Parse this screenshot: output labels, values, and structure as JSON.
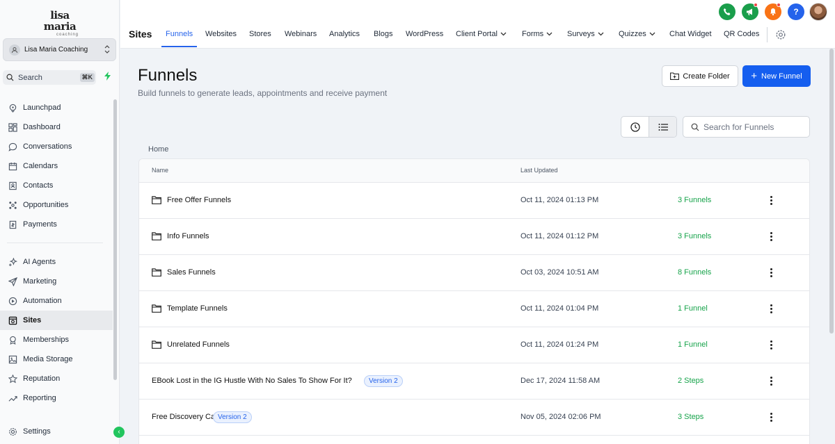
{
  "brand": {
    "logo_main": "lisa maria",
    "logo_sub": "coaching"
  },
  "account": {
    "name": "Lisa Maria Coaching"
  },
  "sidebar_search": {
    "label": "Search",
    "shortcut": "⌘K"
  },
  "sidebar": {
    "items": [
      {
        "label": "Launchpad",
        "icon": "rocket-icon"
      },
      {
        "label": "Dashboard",
        "icon": "grid-icon"
      },
      {
        "label": "Conversations",
        "icon": "chat-icon"
      },
      {
        "label": "Calendars",
        "icon": "calendar-icon"
      },
      {
        "label": "Contacts",
        "icon": "contacts-icon"
      },
      {
        "label": "Opportunities",
        "icon": "opportunities-icon"
      },
      {
        "label": "Payments",
        "icon": "payments-icon"
      },
      {
        "label": "AI Agents",
        "icon": "sparkle-icon"
      },
      {
        "label": "Marketing",
        "icon": "send-icon"
      },
      {
        "label": "Automation",
        "icon": "automation-icon"
      },
      {
        "label": "Sites",
        "icon": "sites-icon",
        "active": true
      },
      {
        "label": "Memberships",
        "icon": "award-icon"
      },
      {
        "label": "Media Storage",
        "icon": "image-icon"
      },
      {
        "label": "Reputation",
        "icon": "star-icon"
      },
      {
        "label": "Reporting",
        "icon": "trend-icon"
      }
    ],
    "settings": "Settings"
  },
  "topbar": {
    "section_title": "Sites",
    "tabs": [
      {
        "label": "Funnels",
        "active": true
      },
      {
        "label": "Websites"
      },
      {
        "label": "Stores"
      },
      {
        "label": "Webinars"
      },
      {
        "label": "Analytics"
      },
      {
        "label": "Blogs"
      },
      {
        "label": "WordPress"
      },
      {
        "label": "Client Portal",
        "dropdown": true
      },
      {
        "label": "Forms",
        "dropdown": true
      },
      {
        "label": "Surveys",
        "dropdown": true
      },
      {
        "label": "Quizzes",
        "dropdown": true
      },
      {
        "label": "Chat Widget"
      },
      {
        "label": "QR Codes"
      }
    ],
    "icons": [
      {
        "name": "phone-icon",
        "color": "#1a9e4b"
      },
      {
        "name": "megaphone-icon",
        "color": "#1a9e4b"
      },
      {
        "name": "bell-icon",
        "color": "#f97316"
      },
      {
        "name": "help-icon",
        "color": "#2563eb"
      }
    ]
  },
  "page": {
    "title": "Funnels",
    "subtitle": "Build funnels to generate leads, appointments and receive payment",
    "create_folder": "Create Folder",
    "new_funnel": "New Funnel",
    "search_placeholder": "Search for Funnels",
    "breadcrumb": "Home"
  },
  "table": {
    "columns": {
      "name": "Name",
      "last_updated": "Last Updated"
    },
    "rows": [
      {
        "type": "folder",
        "name": "Free Offer Funnels",
        "date": "Oct 11, 2024 01:13 PM",
        "count": "3 Funnels"
      },
      {
        "type": "folder",
        "name": "Info Funnels",
        "date": "Oct 11, 2024 01:12 PM",
        "count": "3 Funnels"
      },
      {
        "type": "folder",
        "name": "Sales Funnels",
        "date": "Oct 03, 2024 10:51 AM",
        "count": "8 Funnels"
      },
      {
        "type": "folder",
        "name": "Template Funnels",
        "date": "Oct 11, 2024 01:04 PM",
        "count": "1 Funnel"
      },
      {
        "type": "folder",
        "name": "Unrelated Funnels",
        "date": "Oct 11, 2024 01:24 PM",
        "count": "1 Funnel"
      },
      {
        "type": "funnel",
        "name": "EBook Lost in the IG Hustle With No Sales To Show For It?",
        "badge": "Version 2",
        "date": "Dec 17, 2024 11:58 AM",
        "count": "2 Steps"
      },
      {
        "type": "funnel",
        "name": "Free Discovery Call",
        "badge": "Version 2",
        "date": "Nov 05, 2024 02:06 PM",
        "count": "3 Steps"
      }
    ]
  }
}
